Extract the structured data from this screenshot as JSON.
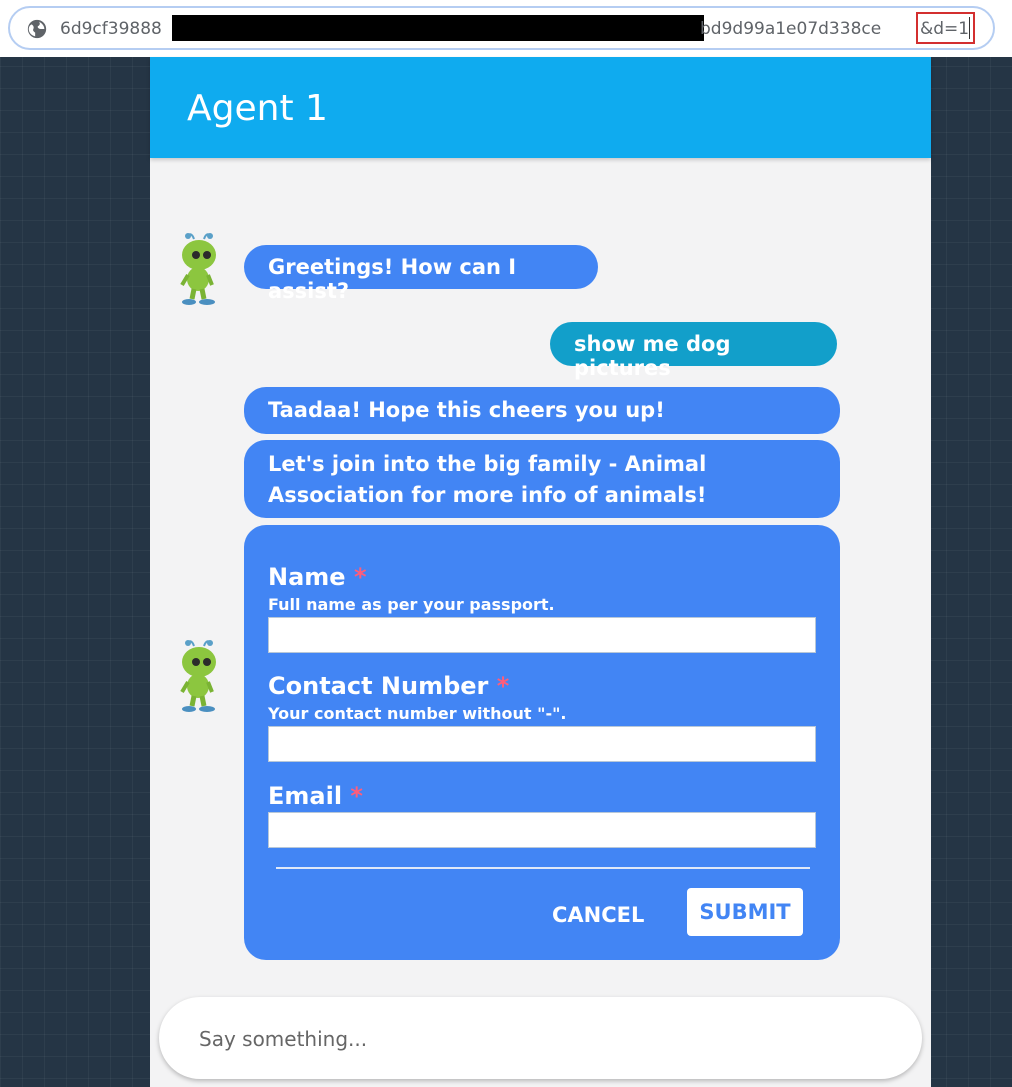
{
  "browser": {
    "url_start": "6d9cf39888",
    "url_end": "bd9d99a1e07d338ce",
    "url_param": "&d=1"
  },
  "chat": {
    "title": "Agent 1",
    "messages": {
      "greeting": "Greetings! How can I assist?",
      "user": "show me dog pictures",
      "tada": "Taadaa! Hope this cheers you up!",
      "join_line1": "Let's join into the big family - Animal",
      "join_line2": "Association for more info of animals!"
    },
    "form": {
      "name_label": "Name",
      "name_help": "Full name as per your passport.",
      "contact_label": "Contact Number",
      "contact_help": "Your contact number without \"-\".",
      "email_label": "Email",
      "required_mark": "*",
      "cancel": "CANCEL",
      "submit": "SUBMIT"
    },
    "composer": {
      "placeholder": "Say something..."
    }
  },
  "colors": {
    "header": "#0fabef",
    "bot_bubble": "#4285f4",
    "user_bubble": "#129fca",
    "required_star": "#ff5d7a",
    "background": "#253545"
  }
}
